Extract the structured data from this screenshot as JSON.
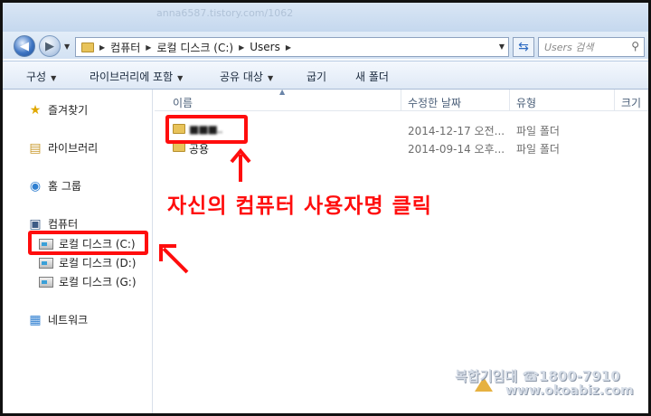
{
  "titlebar": {
    "faint_text": "anna6587.tistory.com/1062"
  },
  "address": {
    "segments": [
      "컴퓨터",
      "로컬 디스크 (C:)",
      "Users"
    ],
    "search_placeholder": "Users 검색"
  },
  "toolbar": {
    "organize": "구성",
    "include_library": "라이브러리에 포함",
    "share_with": "공유 대상",
    "burn": "굽기",
    "new_folder": "새 폴더"
  },
  "sidebar": {
    "favorites": "즐겨찾기",
    "libraries": "라이브러리",
    "homegroup": "홈 그룹",
    "computer": "컴퓨터",
    "drives": [
      "로컬 디스크 (C:)",
      "로컬 디스크 (D:)",
      "로컬 디스크 (G:)"
    ],
    "network": "네트워크"
  },
  "columns": {
    "name": "이름",
    "date": "수정한 날짜",
    "type": "유형",
    "size": "크기"
  },
  "rows": [
    {
      "name": "■■■..",
      "date": "2014-12-17 오전...",
      "type": "파일 폴더"
    },
    {
      "name": "공용",
      "date": "2014-09-14 오후...",
      "type": "파일 폴더"
    }
  ],
  "annotation": {
    "text": "자신의 컴퓨터 사용자명 클릭",
    "color": "#ff0d0d"
  },
  "watermark": {
    "line1": "복합기임대 ☎1800-7910",
    "line2": "www.okoabiz.com"
  }
}
